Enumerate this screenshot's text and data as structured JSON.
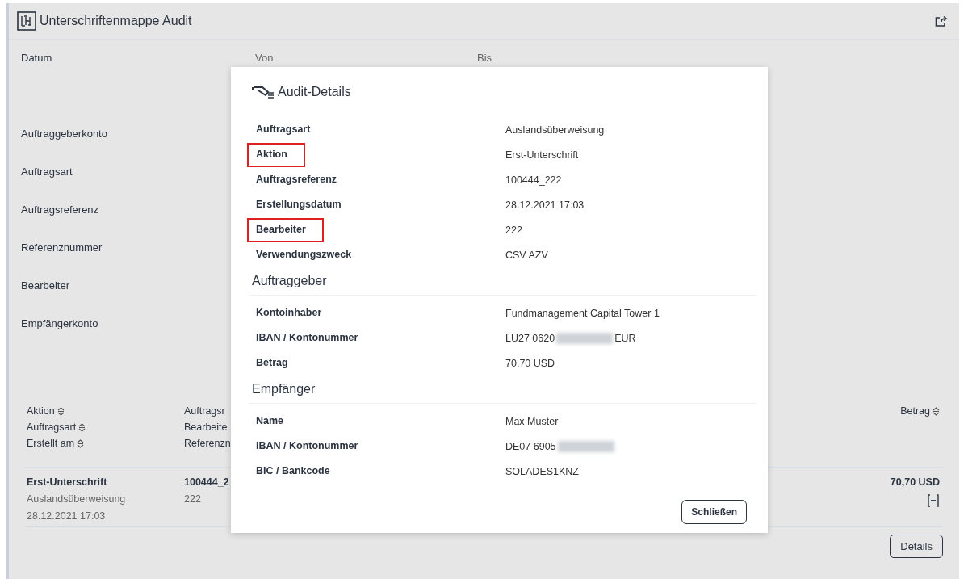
{
  "header": {
    "title": "Unterschriftenmappe Audit"
  },
  "date_filter": {
    "label": "Datum",
    "from": "Von",
    "to": "Bis"
  },
  "filters": [
    "Auftraggeberkonto",
    "Auftragsart",
    "Auftragsreferenz",
    "Referenznummer",
    "Bearbeiter",
    "Empfängerkonto"
  ],
  "table": {
    "columns": [
      {
        "lines": [
          "Aktion",
          "Auftragsart",
          "Erstellt am"
        ],
        "sortable": true
      },
      {
        "lines": [
          "Auftragsr",
          "Bearbeite",
          "Referenzn"
        ],
        "sortable": false
      },
      {
        "lines": [
          "Betrag"
        ],
        "sortable": true
      }
    ],
    "rows": [
      {
        "cells": [
          [
            "Erst-Unterschrift",
            "Auslandsüberweisung",
            "28.12.2021 17:03"
          ],
          [
            "100444_2",
            "222"
          ],
          [
            "70,70 USD"
          ]
        ],
        "expanded": true
      }
    ],
    "details_button": "Details"
  },
  "dialog": {
    "title": "Audit-Details",
    "sections": [
      {
        "rows": [
          {
            "label": "Auftragsart",
            "value": "Auslandsüberweisung",
            "highlighted": false,
            "redacted": false
          },
          {
            "label": "Aktion",
            "value": "Erst-Unterschrift",
            "highlighted": true,
            "redacted": false
          },
          {
            "label": "Auftragsreferenz",
            "value": "100444_222",
            "highlighted": false,
            "redacted": false
          },
          {
            "label": "Erstellungsdatum",
            "value": "28.12.2021 17:03",
            "highlighted": false,
            "redacted": false
          },
          {
            "label": "Bearbeiter",
            "value": "222",
            "highlighted": true,
            "redacted": false
          },
          {
            "label": "Verwendungszweck",
            "value": "CSV AZV",
            "highlighted": false,
            "redacted": false
          }
        ]
      },
      {
        "heading": "Auftraggeber",
        "rows": [
          {
            "label": "Kontoinhaber",
            "value": "Fundmanagement Capital Tower 1",
            "highlighted": false,
            "redacted": false
          },
          {
            "label": "IBAN / Kontonummer",
            "value": "LU27 0620",
            "value_suffix": "EUR",
            "highlighted": false,
            "redacted": true
          },
          {
            "label": "Betrag",
            "value": "70,70 USD",
            "highlighted": false,
            "redacted": false
          }
        ]
      },
      {
        "heading": "Empfänger",
        "rows": [
          {
            "label": "Name",
            "value": "Max Muster",
            "highlighted": false,
            "redacted": false
          },
          {
            "label": "IBAN / Kontonummer",
            "value": "DE07 6905",
            "highlighted": false,
            "redacted": true
          },
          {
            "label": "BIC / Bankcode",
            "value": "SOLADES1KNZ",
            "highlighted": false,
            "redacted": false
          }
        ]
      }
    ],
    "close_button": "Schließen"
  }
}
